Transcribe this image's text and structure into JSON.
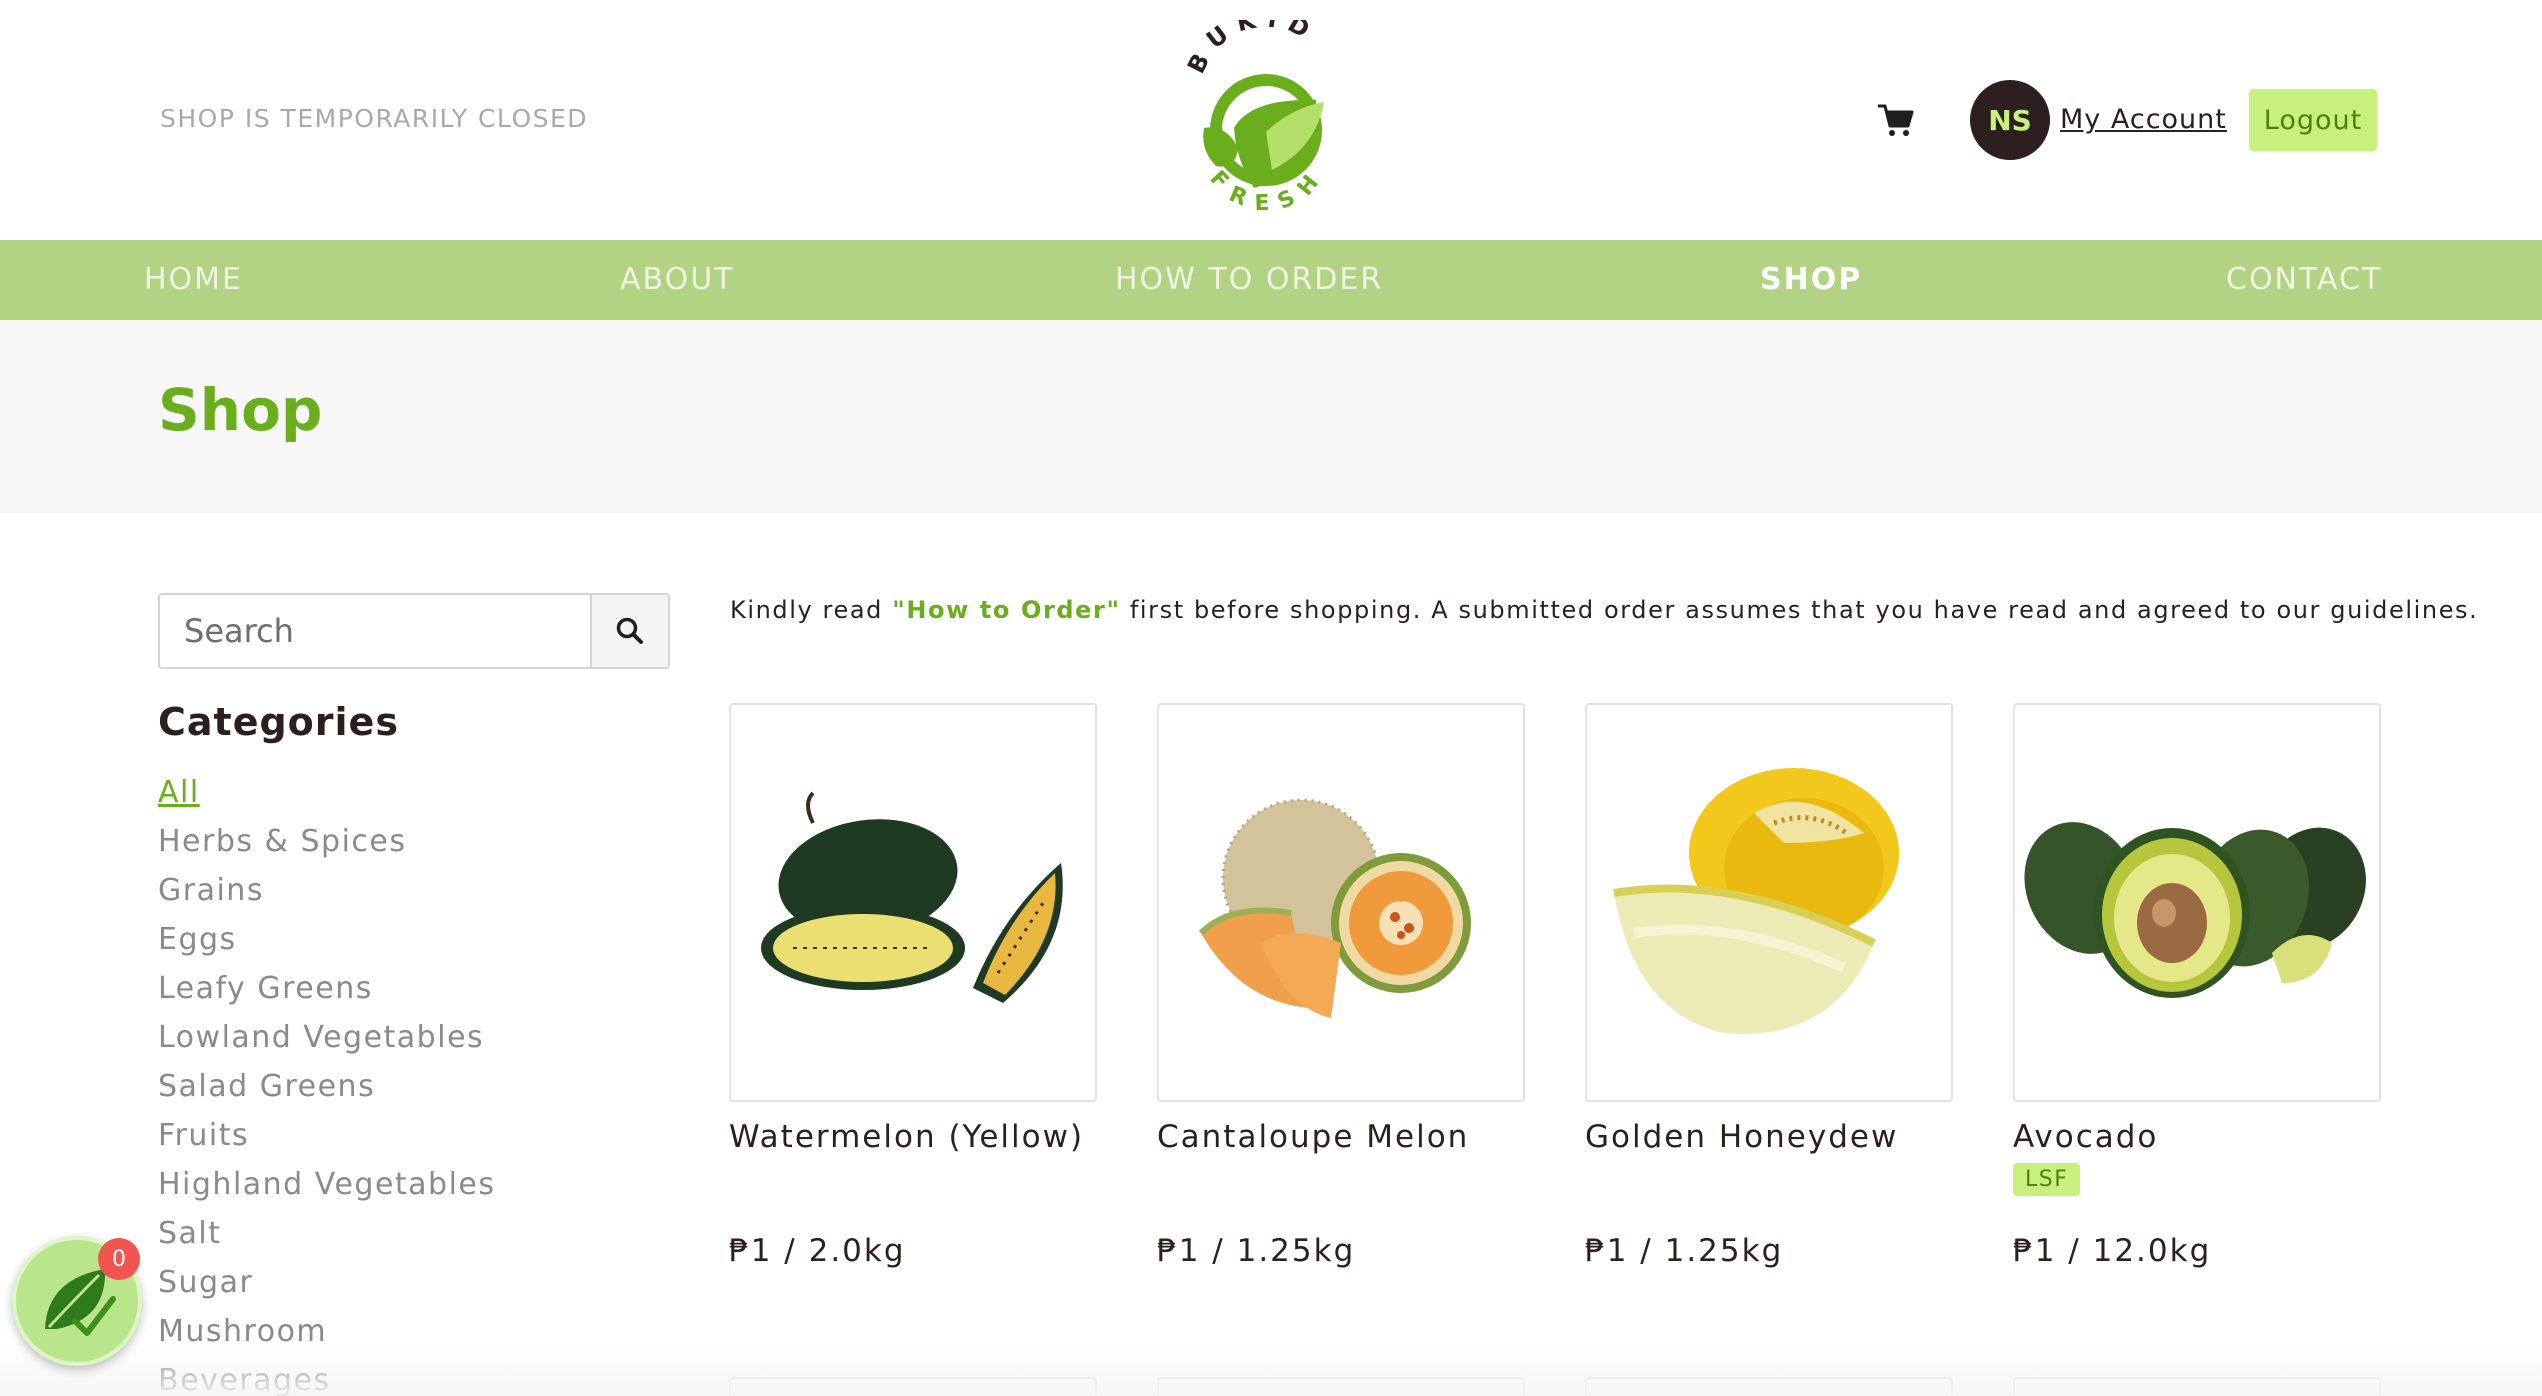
{
  "header": {
    "shop_status": "SHOP IS TEMPORARILY CLOSED",
    "logo_top_text": "BUKID",
    "logo_bottom_text": "FRESH",
    "avatar_initials": "NS",
    "my_account_label": "My Account",
    "logout_label": "Logout",
    "cart_icon": "shopping-cart-icon"
  },
  "nav": {
    "items": [
      {
        "label": "HOME"
      },
      {
        "label": "ABOUT"
      },
      {
        "label": "HOW TO ORDER"
      },
      {
        "label": "SHOP",
        "active": true
      },
      {
        "label": "CONTACT"
      }
    ]
  },
  "page": {
    "title": "Shop"
  },
  "sidebar": {
    "search_placeholder": "Search",
    "search_icon": "search-icon",
    "categories_title": "Categories",
    "categories": [
      {
        "label": "All",
        "active": true
      },
      {
        "label": "Herbs & Spices"
      },
      {
        "label": "Grains"
      },
      {
        "label": "Eggs"
      },
      {
        "label": "Leafy Greens"
      },
      {
        "label": "Lowland Vegetables"
      },
      {
        "label": "Salad Greens"
      },
      {
        "label": "Fruits"
      },
      {
        "label": "Highland Vegetables"
      },
      {
        "label": "Salt"
      },
      {
        "label": "Sugar"
      },
      {
        "label": "Mushroom"
      },
      {
        "label": "Beverages"
      }
    ]
  },
  "main": {
    "notice_prefix": "Kindly read ",
    "notice_link": "\"How to Order\"",
    "notice_suffix": " first before shopping. A submitted order assumes that you have read and agreed to our guidelines.",
    "products": [
      {
        "name": "Watermelon (Yellow)",
        "price": "₱1 / 2.0kg",
        "badge": ""
      },
      {
        "name": "Cantaloupe Melon",
        "price": "₱1 / 1.25kg",
        "badge": ""
      },
      {
        "name": "Golden Honeydew",
        "price": "₱1 / 1.25kg",
        "badge": ""
      },
      {
        "name": "Avocado",
        "price": "₱1 / 12.0kg",
        "badge": "LSF"
      }
    ]
  },
  "floating": {
    "badge_count": "0",
    "icon": "leaf-check-icon"
  },
  "colors": {
    "brand_green": "#6aae1d",
    "nav_green": "#b2d384",
    "button_lime": "#c8f07d",
    "dark": "#2d1f20"
  }
}
